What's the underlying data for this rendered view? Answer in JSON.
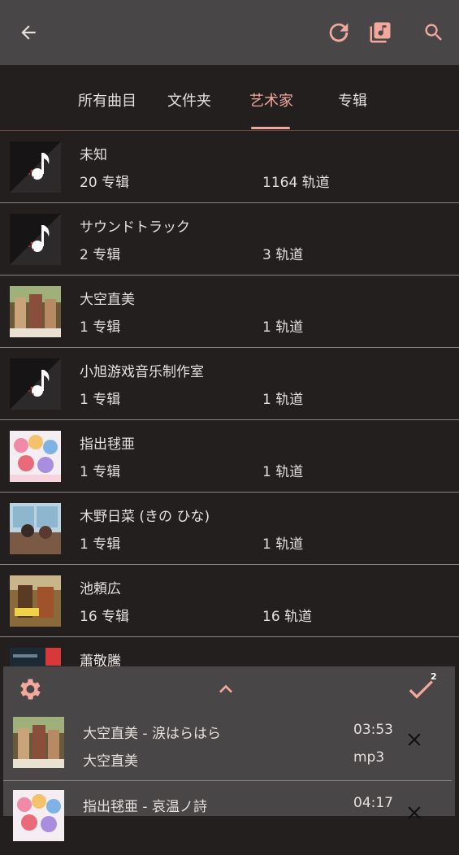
{
  "header": {
    "back_icon": "arrow-left-icon",
    "refresh_icon": "refresh-icon",
    "library_icon": "music-library-icon",
    "search_icon": "search-icon"
  },
  "tabs": [
    {
      "label": "所有曲目"
    },
    {
      "label": "文件夹"
    },
    {
      "label": "艺术家"
    },
    {
      "label": "专辑"
    }
  ],
  "active_tab": "艺术家",
  "artists": [
    {
      "name": "未知",
      "albums": "20 专辑",
      "tracks": "1164 轨道",
      "art": "music-note-placeholder"
    },
    {
      "name": "サウンドトラック",
      "albums": "2 专辑",
      "tracks": "3 轨道",
      "art": "music-note-placeholder"
    },
    {
      "name": "大空直美",
      "albums": "1 专辑",
      "tracks": "1 轨道",
      "art": "album-art"
    },
    {
      "name": "小旭游戏音乐制作室",
      "albums": "1 专辑",
      "tracks": "1 轨道",
      "art": "music-note-placeholder"
    },
    {
      "name": "指出毬亜",
      "albums": "1 专辑",
      "tracks": "1 轨道",
      "art": "album-art"
    },
    {
      "name": "木野日菜 (きの ひな)",
      "albums": "1 专辑",
      "tracks": "1 轨道",
      "art": "album-art"
    },
    {
      "name": "池頼広",
      "albums": "16 专辑",
      "tracks": "16 轨道",
      "art": "album-art"
    },
    {
      "name": "蕭敬騰",
      "albums": "",
      "tracks": "",
      "art": "album-art"
    }
  ],
  "queue_panel": {
    "settings_icon": "gear-icon",
    "expand_icon": "chevron-up-icon",
    "confirm_icon": "checkmark-icon",
    "badge": "2",
    "items": [
      {
        "title": "大空直美 - 涙はらはら",
        "artist": "大空直美",
        "duration": "03:53",
        "format": "mp3"
      },
      {
        "title": "指出毬亜 - 哀温ノ詩",
        "artist": "",
        "duration": "04:17",
        "format": ""
      }
    ]
  },
  "colors": {
    "accent": "#f2a89c",
    "background": "#231f1f",
    "bar": "#484646"
  }
}
